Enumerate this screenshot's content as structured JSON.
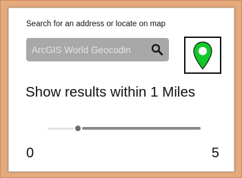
{
  "search": {
    "caption": "Search for an address or locate on map",
    "placeholder": "ArcGIS World Geocodin",
    "search_icon": "search-icon",
    "locate_icon": "map-pin-icon",
    "locate_color": "#13c82a"
  },
  "radius": {
    "label": "Show results within 1 Miles",
    "min_label": "0",
    "max_label": "5",
    "min": 0,
    "max": 5,
    "value": 1
  }
}
